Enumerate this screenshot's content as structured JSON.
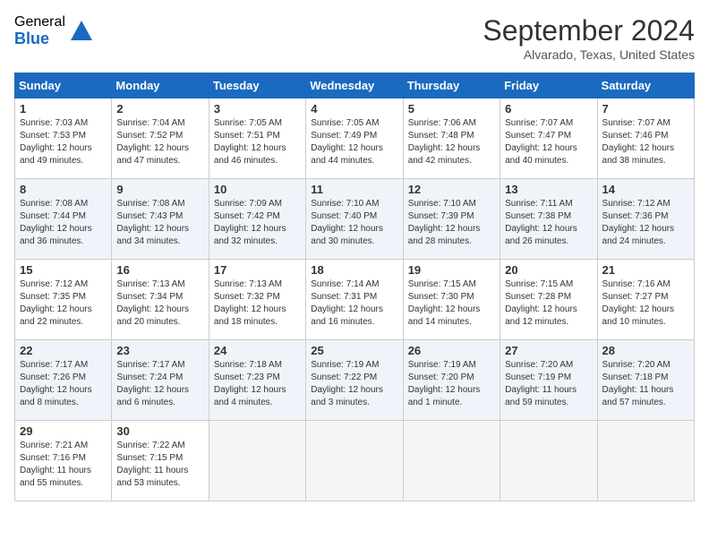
{
  "logo": {
    "general": "General",
    "blue": "Blue"
  },
  "title": "September 2024",
  "location": "Alvarado, Texas, United States",
  "weekdays": [
    "Sunday",
    "Monday",
    "Tuesday",
    "Wednesday",
    "Thursday",
    "Friday",
    "Saturday"
  ],
  "weeks": [
    [
      {
        "day": "1",
        "sunrise": "7:03 AM",
        "sunset": "7:53 PM",
        "daylight": "12 hours and 49 minutes."
      },
      {
        "day": "2",
        "sunrise": "7:04 AM",
        "sunset": "7:52 PM",
        "daylight": "12 hours and 47 minutes."
      },
      {
        "day": "3",
        "sunrise": "7:05 AM",
        "sunset": "7:51 PM",
        "daylight": "12 hours and 46 minutes."
      },
      {
        "day": "4",
        "sunrise": "7:05 AM",
        "sunset": "7:49 PM",
        "daylight": "12 hours and 44 minutes."
      },
      {
        "day": "5",
        "sunrise": "7:06 AM",
        "sunset": "7:48 PM",
        "daylight": "12 hours and 42 minutes."
      },
      {
        "day": "6",
        "sunrise": "7:07 AM",
        "sunset": "7:47 PM",
        "daylight": "12 hours and 40 minutes."
      },
      {
        "day": "7",
        "sunrise": "7:07 AM",
        "sunset": "7:46 PM",
        "daylight": "12 hours and 38 minutes."
      }
    ],
    [
      {
        "day": "8",
        "sunrise": "7:08 AM",
        "sunset": "7:44 PM",
        "daylight": "12 hours and 36 minutes."
      },
      {
        "day": "9",
        "sunrise": "7:08 AM",
        "sunset": "7:43 PM",
        "daylight": "12 hours and 34 minutes."
      },
      {
        "day": "10",
        "sunrise": "7:09 AM",
        "sunset": "7:42 PM",
        "daylight": "12 hours and 32 minutes."
      },
      {
        "day": "11",
        "sunrise": "7:10 AM",
        "sunset": "7:40 PM",
        "daylight": "12 hours and 30 minutes."
      },
      {
        "day": "12",
        "sunrise": "7:10 AM",
        "sunset": "7:39 PM",
        "daylight": "12 hours and 28 minutes."
      },
      {
        "day": "13",
        "sunrise": "7:11 AM",
        "sunset": "7:38 PM",
        "daylight": "12 hours and 26 minutes."
      },
      {
        "day": "14",
        "sunrise": "7:12 AM",
        "sunset": "7:36 PM",
        "daylight": "12 hours and 24 minutes."
      }
    ],
    [
      {
        "day": "15",
        "sunrise": "7:12 AM",
        "sunset": "7:35 PM",
        "daylight": "12 hours and 22 minutes."
      },
      {
        "day": "16",
        "sunrise": "7:13 AM",
        "sunset": "7:34 PM",
        "daylight": "12 hours and 20 minutes."
      },
      {
        "day": "17",
        "sunrise": "7:13 AM",
        "sunset": "7:32 PM",
        "daylight": "12 hours and 18 minutes."
      },
      {
        "day": "18",
        "sunrise": "7:14 AM",
        "sunset": "7:31 PM",
        "daylight": "12 hours and 16 minutes."
      },
      {
        "day": "19",
        "sunrise": "7:15 AM",
        "sunset": "7:30 PM",
        "daylight": "12 hours and 14 minutes."
      },
      {
        "day": "20",
        "sunrise": "7:15 AM",
        "sunset": "7:28 PM",
        "daylight": "12 hours and 12 minutes."
      },
      {
        "day": "21",
        "sunrise": "7:16 AM",
        "sunset": "7:27 PM",
        "daylight": "12 hours and 10 minutes."
      }
    ],
    [
      {
        "day": "22",
        "sunrise": "7:17 AM",
        "sunset": "7:26 PM",
        "daylight": "12 hours and 8 minutes."
      },
      {
        "day": "23",
        "sunrise": "7:17 AM",
        "sunset": "7:24 PM",
        "daylight": "12 hours and 6 minutes."
      },
      {
        "day": "24",
        "sunrise": "7:18 AM",
        "sunset": "7:23 PM",
        "daylight": "12 hours and 4 minutes."
      },
      {
        "day": "25",
        "sunrise": "7:19 AM",
        "sunset": "7:22 PM",
        "daylight": "12 hours and 3 minutes."
      },
      {
        "day": "26",
        "sunrise": "7:19 AM",
        "sunset": "7:20 PM",
        "daylight": "12 hours and 1 minute."
      },
      {
        "day": "27",
        "sunrise": "7:20 AM",
        "sunset": "7:19 PM",
        "daylight": "11 hours and 59 minutes."
      },
      {
        "day": "28",
        "sunrise": "7:20 AM",
        "sunset": "7:18 PM",
        "daylight": "11 hours and 57 minutes."
      }
    ],
    [
      {
        "day": "29",
        "sunrise": "7:21 AM",
        "sunset": "7:16 PM",
        "daylight": "11 hours and 55 minutes."
      },
      {
        "day": "30",
        "sunrise": "7:22 AM",
        "sunset": "7:15 PM",
        "daylight": "11 hours and 53 minutes."
      },
      null,
      null,
      null,
      null,
      null
    ]
  ]
}
